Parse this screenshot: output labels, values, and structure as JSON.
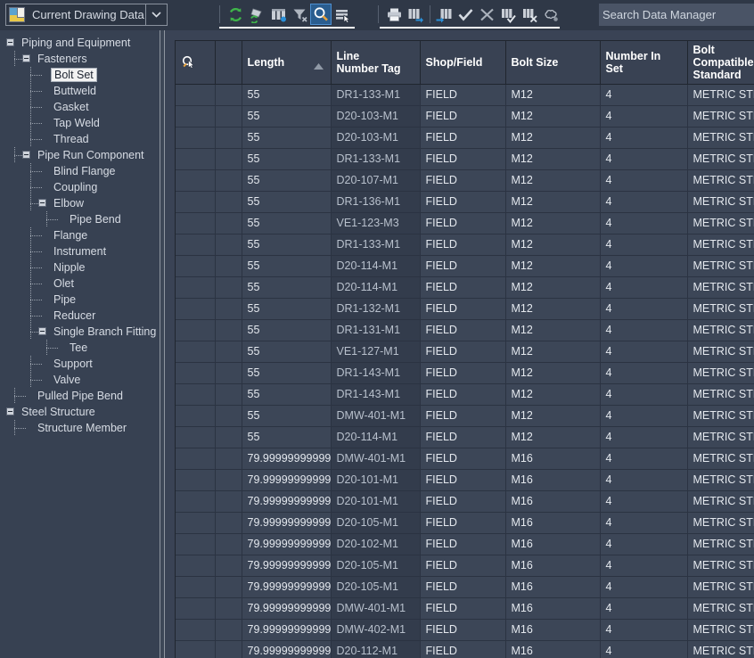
{
  "topbar": {
    "combo": {
      "value": "Current Drawing Data",
      "icon": "drawing-data-icon",
      "arrow_icon": "chevron-down-icon"
    },
    "tools_left": [
      {
        "name": "refresh-icon",
        "label": "Refresh",
        "active": false
      },
      {
        "name": "refresh-object-icon",
        "label": "Refresh Objects",
        "active": false
      },
      {
        "name": "columns-icon",
        "label": "Configure Columns",
        "active": false
      },
      {
        "name": "filter-clear-icon",
        "label": "Clear Filter",
        "active": false
      },
      {
        "name": "search-icon",
        "label": "Find",
        "active": true
      },
      {
        "name": "select-rows-icon",
        "label": "Select Rows",
        "active": false
      }
    ],
    "tools_right": [
      {
        "name": "print-icon",
        "label": "Print"
      },
      {
        "name": "export-icon",
        "label": "Export"
      },
      {
        "name": "import-icon",
        "label": "Import"
      },
      {
        "name": "accept-icon",
        "label": "Accept Changes"
      },
      {
        "name": "cancel-icon",
        "label": "Cancel Changes"
      },
      {
        "name": "validate-rows-icon",
        "label": "Validate Rows"
      },
      {
        "name": "delete-rows-icon",
        "label": "Delete Rows"
      },
      {
        "name": "cloud-icon",
        "label": "Revision Cloud"
      }
    ],
    "search": {
      "placeholder": "Search Data Manager",
      "value": ""
    }
  },
  "tree": {
    "items": [
      {
        "label": "Piping and Equipment",
        "depth": 0,
        "toggle": "minus",
        "selected": false
      },
      {
        "label": "Fasteners",
        "depth": 1,
        "toggle": "minus",
        "selected": false
      },
      {
        "label": "Bolt Set",
        "depth": 2,
        "toggle": "none",
        "selected": true
      },
      {
        "label": "Buttweld",
        "depth": 2,
        "toggle": "none",
        "selected": false
      },
      {
        "label": "Gasket",
        "depth": 2,
        "toggle": "none",
        "selected": false
      },
      {
        "label": "Tap Weld",
        "depth": 2,
        "toggle": "none",
        "selected": false
      },
      {
        "label": "Thread",
        "depth": 2,
        "toggle": "none",
        "selected": false
      },
      {
        "label": "Pipe Run Component",
        "depth": 1,
        "toggle": "minus",
        "selected": false
      },
      {
        "label": "Blind Flange",
        "depth": 2,
        "toggle": "none",
        "selected": false
      },
      {
        "label": "Coupling",
        "depth": 2,
        "toggle": "none",
        "selected": false
      },
      {
        "label": "Elbow",
        "depth": 2,
        "toggle": "minus",
        "selected": false
      },
      {
        "label": "Pipe Bend",
        "depth": 3,
        "toggle": "none",
        "selected": false
      },
      {
        "label": "Flange",
        "depth": 2,
        "toggle": "none",
        "selected": false
      },
      {
        "label": "Instrument",
        "depth": 2,
        "toggle": "none",
        "selected": false
      },
      {
        "label": "Nipple",
        "depth": 2,
        "toggle": "none",
        "selected": false
      },
      {
        "label": "Olet",
        "depth": 2,
        "toggle": "none",
        "selected": false
      },
      {
        "label": "Pipe",
        "depth": 2,
        "toggle": "none",
        "selected": false
      },
      {
        "label": "Reducer",
        "depth": 2,
        "toggle": "none",
        "selected": false
      },
      {
        "label": "Single Branch Fitting",
        "depth": 2,
        "toggle": "minus",
        "selected": false
      },
      {
        "label": "Tee",
        "depth": 3,
        "toggle": "none",
        "selected": false
      },
      {
        "label": "Support",
        "depth": 2,
        "toggle": "none",
        "selected": false
      },
      {
        "label": "Valve",
        "depth": 2,
        "toggle": "none",
        "selected": false
      },
      {
        "label": "Pulled Pipe Bend",
        "depth": 1,
        "toggle": "none",
        "selected": false
      },
      {
        "label": "Steel Structure",
        "depth": 0,
        "toggle": "minus",
        "selected": false
      },
      {
        "label": "Structure Member",
        "depth": 1,
        "toggle": "none",
        "selected": false
      }
    ]
  },
  "grid": {
    "columns": [
      {
        "key": "select",
        "label": "",
        "icon": "select-cursor-icon",
        "sorted": false
      },
      {
        "key": "blank",
        "label": "",
        "sorted": false
      },
      {
        "key": "length",
        "label": "Length",
        "sorted": true,
        "sort_dir": "asc"
      },
      {
        "key": "line_number_tag",
        "label": "Line\nNumber Tag",
        "sorted": false,
        "highlight": true
      },
      {
        "key": "shop_field",
        "label": "Shop/Field",
        "sorted": false
      },
      {
        "key": "bolt_size",
        "label": "Bolt Size",
        "sorted": false
      },
      {
        "key": "number_in_set",
        "label": "Number In\nSet",
        "sorted": false
      },
      {
        "key": "bolt_compatible_standard",
        "label": "Bolt\nCompatible\nStandard",
        "sorted": false
      }
    ],
    "rows": [
      {
        "length": "55",
        "line_number_tag": "DR1-133-M1",
        "shop_field": "FIELD",
        "bolt_size": "M12",
        "number_in_set": "4",
        "bolt_compatible_standard": "METRIC STD"
      },
      {
        "length": "55",
        "line_number_tag": "D20-103-M1",
        "shop_field": "FIELD",
        "bolt_size": "M12",
        "number_in_set": "4",
        "bolt_compatible_standard": "METRIC STD"
      },
      {
        "length": "55",
        "line_number_tag": "D20-103-M1",
        "shop_field": "FIELD",
        "bolt_size": "M12",
        "number_in_set": "4",
        "bolt_compatible_standard": "METRIC STD"
      },
      {
        "length": "55",
        "line_number_tag": "DR1-133-M1",
        "shop_field": "FIELD",
        "bolt_size": "M12",
        "number_in_set": "4",
        "bolt_compatible_standard": "METRIC STD"
      },
      {
        "length": "55",
        "line_number_tag": "D20-107-M1",
        "shop_field": "FIELD",
        "bolt_size": "M12",
        "number_in_set": "4",
        "bolt_compatible_standard": "METRIC STD"
      },
      {
        "length": "55",
        "line_number_tag": "DR1-136-M1",
        "shop_field": "FIELD",
        "bolt_size": "M12",
        "number_in_set": "4",
        "bolt_compatible_standard": "METRIC STD"
      },
      {
        "length": "55",
        "line_number_tag": "VE1-123-M3",
        "shop_field": "FIELD",
        "bolt_size": "M12",
        "number_in_set": "4",
        "bolt_compatible_standard": "METRIC STD"
      },
      {
        "length": "55",
        "line_number_tag": "DR1-133-M1",
        "shop_field": "FIELD",
        "bolt_size": "M12",
        "number_in_set": "4",
        "bolt_compatible_standard": "METRIC STD"
      },
      {
        "length": "55",
        "line_number_tag": "D20-114-M1",
        "shop_field": "FIELD",
        "bolt_size": "M12",
        "number_in_set": "4",
        "bolt_compatible_standard": "METRIC STD"
      },
      {
        "length": "55",
        "line_number_tag": "D20-114-M1",
        "shop_field": "FIELD",
        "bolt_size": "M12",
        "number_in_set": "4",
        "bolt_compatible_standard": "METRIC STD"
      },
      {
        "length": "55",
        "line_number_tag": "DR1-132-M1",
        "shop_field": "FIELD",
        "bolt_size": "M12",
        "number_in_set": "4",
        "bolt_compatible_standard": "METRIC STD"
      },
      {
        "length": "55",
        "line_number_tag": "DR1-131-M1",
        "shop_field": "FIELD",
        "bolt_size": "M12",
        "number_in_set": "4",
        "bolt_compatible_standard": "METRIC STD"
      },
      {
        "length": "55",
        "line_number_tag": "VE1-127-M1",
        "shop_field": "FIELD",
        "bolt_size": "M12",
        "number_in_set": "4",
        "bolt_compatible_standard": "METRIC STD"
      },
      {
        "length": "55",
        "line_number_tag": "DR1-143-M1",
        "shop_field": "FIELD",
        "bolt_size": "M12",
        "number_in_set": "4",
        "bolt_compatible_standard": "METRIC STD"
      },
      {
        "length": "55",
        "line_number_tag": "DR1-143-M1",
        "shop_field": "FIELD",
        "bolt_size": "M12",
        "number_in_set": "4",
        "bolt_compatible_standard": "METRIC STD"
      },
      {
        "length": "55",
        "line_number_tag": "DMW-401-M1",
        "shop_field": "FIELD",
        "bolt_size": "M12",
        "number_in_set": "4",
        "bolt_compatible_standard": "METRIC STD"
      },
      {
        "length": "55",
        "line_number_tag": "D20-114-M1",
        "shop_field": "FIELD",
        "bolt_size": "M12",
        "number_in_set": "4",
        "bolt_compatible_standard": "METRIC STD"
      },
      {
        "length": "79.99999999999...",
        "line_number_tag": "DMW-401-M1",
        "shop_field": "FIELD",
        "bolt_size": "M16",
        "number_in_set": "4",
        "bolt_compatible_standard": "METRIC STD"
      },
      {
        "length": "79.99999999999...",
        "line_number_tag": "D20-101-M1",
        "shop_field": "FIELD",
        "bolt_size": "M16",
        "number_in_set": "4",
        "bolt_compatible_standard": "METRIC STD"
      },
      {
        "length": "79.99999999999...",
        "line_number_tag": "D20-101-M1",
        "shop_field": "FIELD",
        "bolt_size": "M16",
        "number_in_set": "4",
        "bolt_compatible_standard": "METRIC STD"
      },
      {
        "length": "79.99999999999...",
        "line_number_tag": "D20-105-M1",
        "shop_field": "FIELD",
        "bolt_size": "M16",
        "number_in_set": "4",
        "bolt_compatible_standard": "METRIC STD"
      },
      {
        "length": "79.99999999999...",
        "line_number_tag": "D20-102-M1",
        "shop_field": "FIELD",
        "bolt_size": "M16",
        "number_in_set": "4",
        "bolt_compatible_standard": "METRIC STD"
      },
      {
        "length": "79.99999999999...",
        "line_number_tag": "D20-105-M1",
        "shop_field": "FIELD",
        "bolt_size": "M16",
        "number_in_set": "4",
        "bolt_compatible_standard": "METRIC STD"
      },
      {
        "length": "79.99999999999...",
        "line_number_tag": "D20-105-M1",
        "shop_field": "FIELD",
        "bolt_size": "M16",
        "number_in_set": "4",
        "bolt_compatible_standard": "METRIC STD"
      },
      {
        "length": "79.99999999999...",
        "line_number_tag": "DMW-401-M1",
        "shop_field": "FIELD",
        "bolt_size": "M16",
        "number_in_set": "4",
        "bolt_compatible_standard": "METRIC STD"
      },
      {
        "length": "79.99999999999...",
        "line_number_tag": "DMW-402-M1",
        "shop_field": "FIELD",
        "bolt_size": "M16",
        "number_in_set": "4",
        "bolt_compatible_standard": "METRIC STD"
      },
      {
        "length": "79.99999999999...",
        "line_number_tag": "D20-112-M1",
        "shop_field": "FIELD",
        "bolt_size": "M16",
        "number_in_set": "4",
        "bolt_compatible_standard": "METRIC STD"
      }
    ]
  },
  "colors": {
    "background": "#374152",
    "toolbar": "#2f3847",
    "grid_header": "#394253",
    "grid_cell_border": "#2b3342",
    "highlight_column": "#333c4c",
    "accent_green": "#3fb54a",
    "accent_blue": "#2a8fd8",
    "selection": "#f2f2f2"
  }
}
